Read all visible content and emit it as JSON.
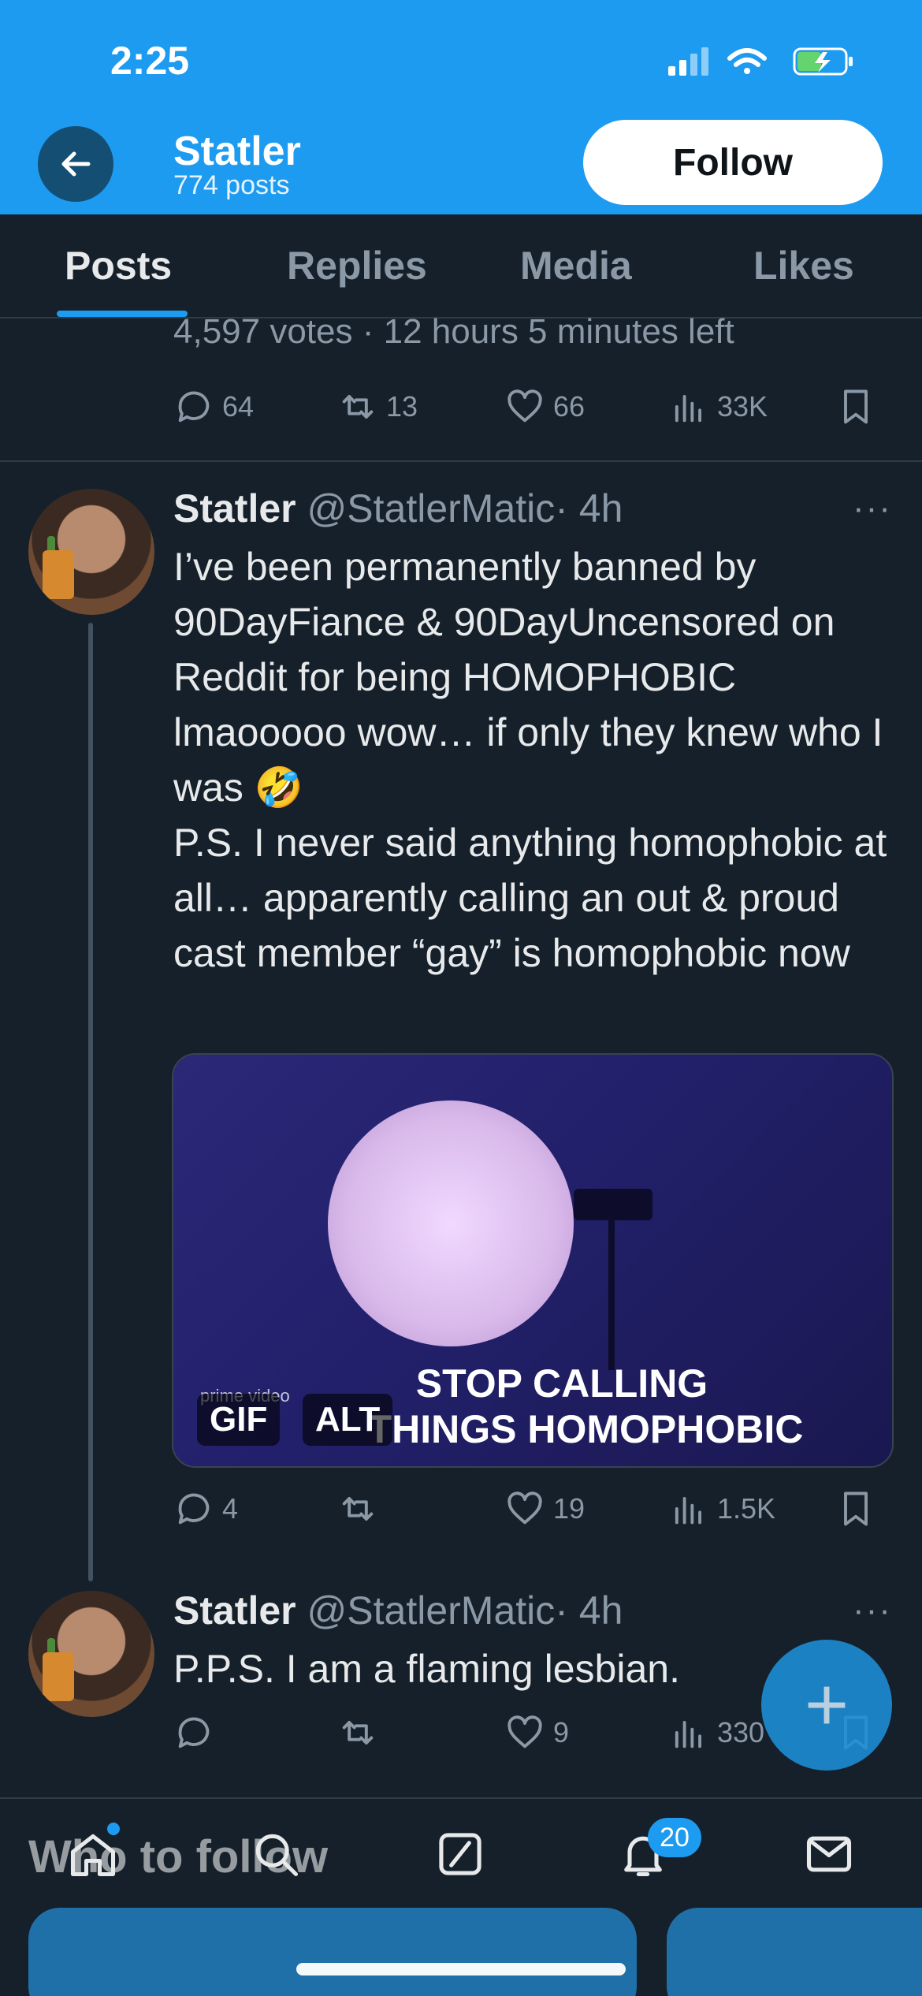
{
  "status_bar": {
    "time": "2:25"
  },
  "header": {
    "name": "Statler",
    "posts": "774 posts",
    "follow_label": "Follow"
  },
  "tabs": [
    {
      "label": "Posts",
      "active": true
    },
    {
      "label": "Replies"
    },
    {
      "label": "Media"
    },
    {
      "label": "Likes"
    }
  ],
  "prev_post": {
    "poll_meta": "4,597 votes · 12 hours 5 minutes left",
    "replies": "64",
    "reposts": "13",
    "likes": "66",
    "views": "33K"
  },
  "tweet1": {
    "name": "Statler",
    "handle": "@StatlerMatic",
    "time": "· 4h",
    "text": "I’ve been permanently banned by 90DayFiance & 90DayUncensored on Reddit for being HOMOPHOBIC lmaooooo wow… if only they knew who I was 🤣\nP.S. I never said anything homophobic at all… apparently calling an out & proud cast member “gay” is homophobic now",
    "media": {
      "caption_line1": "STOP CALLING",
      "caption_line2": "THINGS HOMOPHOBIC",
      "watermark": "prime video",
      "gif_label": "GIF",
      "alt_label": "ALT"
    },
    "replies": "4",
    "reposts": "",
    "likes": "19",
    "views": "1.5K"
  },
  "tweet2": {
    "name": "Statler",
    "handle": "@StatlerMatic",
    "time": "· 4h",
    "text": "P.P.S. I am a flaming lesbian.",
    "replies": "",
    "reposts": "",
    "likes": "9",
    "views": "330"
  },
  "more_glyph": "···",
  "fab_glyph": "+",
  "who_to_follow": "Who to follow",
  "nav": {
    "notifications_badge": "20",
    "icons": [
      "home-icon",
      "search-icon",
      "grok-icon",
      "notifications-icon",
      "messages-icon"
    ]
  },
  "colors": {
    "accent": "#1d9bf0",
    "background": "#15202b",
    "text_secondary": "#8b98a5"
  }
}
